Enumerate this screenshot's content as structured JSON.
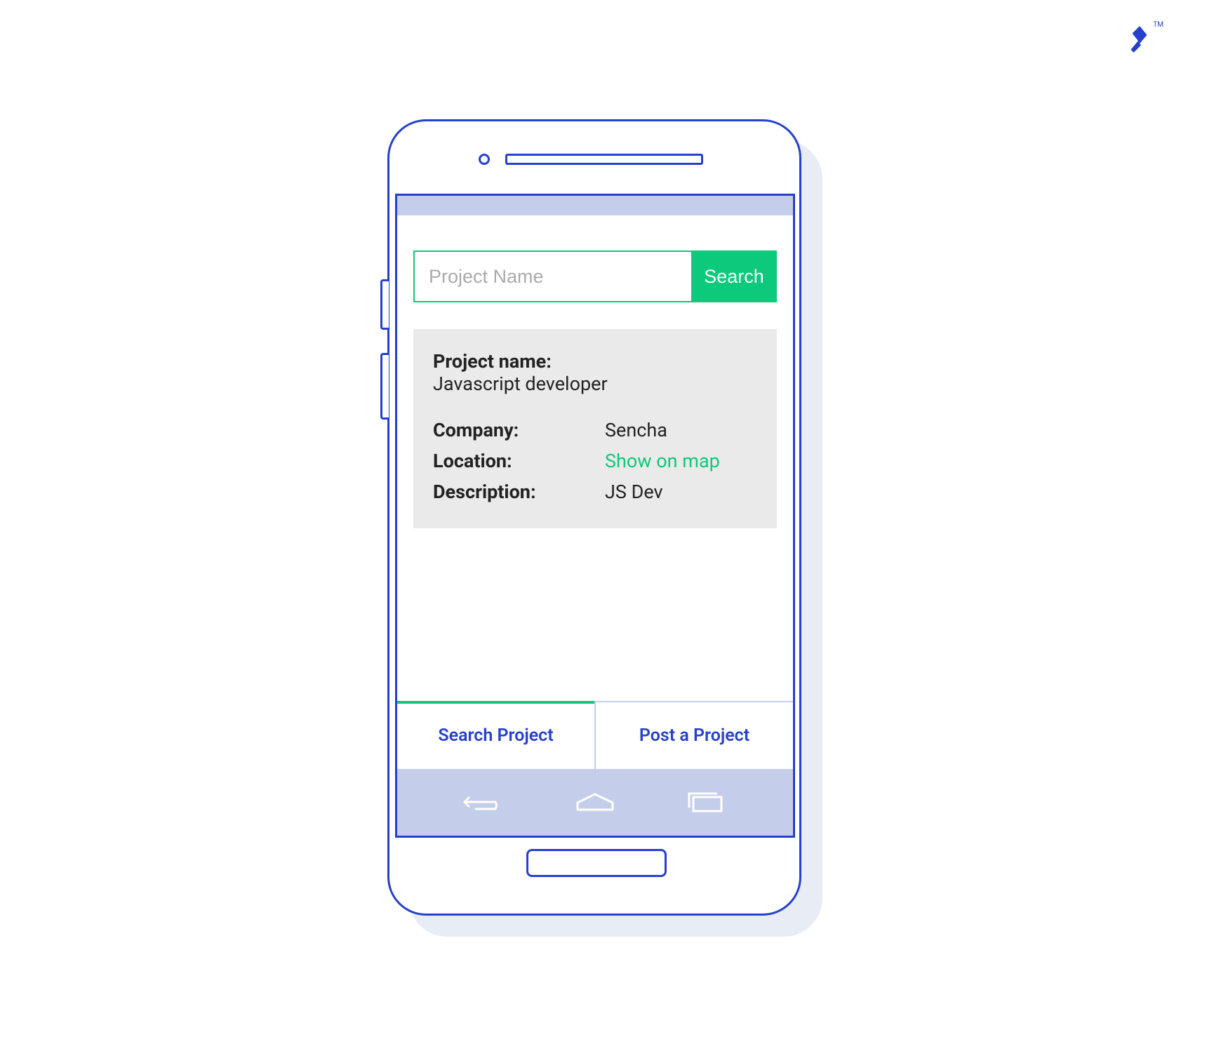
{
  "search": {
    "placeholder": "Project Name",
    "button_label": "Search"
  },
  "project": {
    "name_label": "Project name:",
    "name_value": "Javascript developer",
    "company_label": "Company:",
    "company_value": "Sencha",
    "location_label": "Location:",
    "location_link": "Show on map",
    "description_label": "Description:",
    "description_value": "JS Dev"
  },
  "tabs": {
    "search_project": "Search Project",
    "post_project": "Post a Project"
  }
}
